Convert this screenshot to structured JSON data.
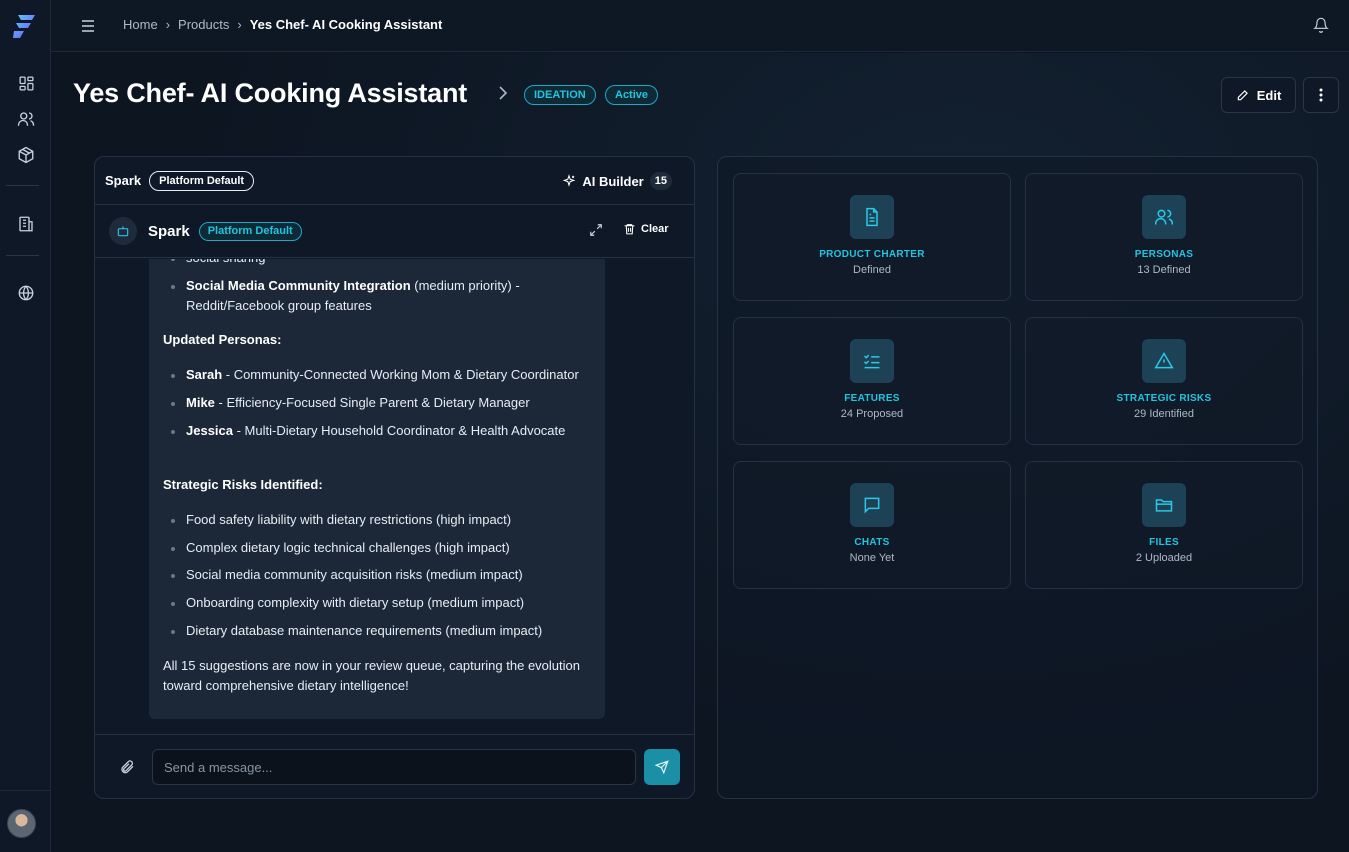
{
  "sidebar": {
    "logo": "brand-logo",
    "items": [
      {
        "name": "dashboard-icon"
      },
      {
        "name": "users-icon"
      },
      {
        "name": "box-icon"
      },
      {
        "name": "building-icon"
      },
      {
        "name": "globe-icon"
      }
    ]
  },
  "breadcrumb": {
    "items": [
      "Home",
      "Products"
    ],
    "current": "Yes Chef- AI Cooking Assistant"
  },
  "header": {
    "title": "Yes Chef- AI Cooking Assistant",
    "stage_badge": "IDEATION",
    "status_badge": "Active",
    "edit_label": "Edit"
  },
  "chat": {
    "top_name": "Spark",
    "top_pill": "Platform Default",
    "ai_builder_label": "AI Builder",
    "ai_builder_count": "15",
    "agent_name": "Spark",
    "agent_pill": "Platform Default",
    "clear_label": "Clear",
    "input_placeholder": "Send a message...",
    "message": {
      "cut_text": "social sharing",
      "list1": [
        {
          "bold": "Social Media Community Integration",
          "rest": " (medium priority) - Reddit/Facebook group features"
        }
      ],
      "personas_heading": "Updated Personas:",
      "personas": [
        {
          "bold": "Sarah",
          "rest": " - Community-Connected Working Mom & Dietary Coordinator"
        },
        {
          "bold": "Mike",
          "rest": " - Efficiency-Focused Single Parent & Dietary Manager"
        },
        {
          "bold": "Jessica",
          "rest": " - Multi-Dietary Household Coordinator & Health Advocate"
        }
      ],
      "risks_heading": "Strategic Risks Identified:",
      "risks": [
        "Food safety liability with dietary restrictions (high impact)",
        "Complex dietary logic technical challenges (high impact)",
        "Social media community acquisition risks (medium impact)",
        "Onboarding complexity with dietary setup (medium impact)",
        "Dietary database maintenance requirements (medium impact)"
      ],
      "closing": "All 15 suggestions are now in your review queue, capturing the evolution toward comprehensive dietary intelligence!"
    }
  },
  "cards": [
    {
      "icon": "document-icon",
      "title": "PRODUCT CHARTER",
      "sub": "Defined"
    },
    {
      "icon": "personas-icon",
      "title": "PERSONAS",
      "sub": "13 Defined"
    },
    {
      "icon": "checklist-icon",
      "title": "FEATURES",
      "sub": "24 Proposed"
    },
    {
      "icon": "warning-icon",
      "title": "STRATEGIC RISKS",
      "sub": "29 Identified"
    },
    {
      "icon": "chat-icon",
      "title": "CHATS",
      "sub": "None Yet"
    },
    {
      "icon": "folder-icon",
      "title": "FILES",
      "sub": "2 Uploaded"
    }
  ]
}
